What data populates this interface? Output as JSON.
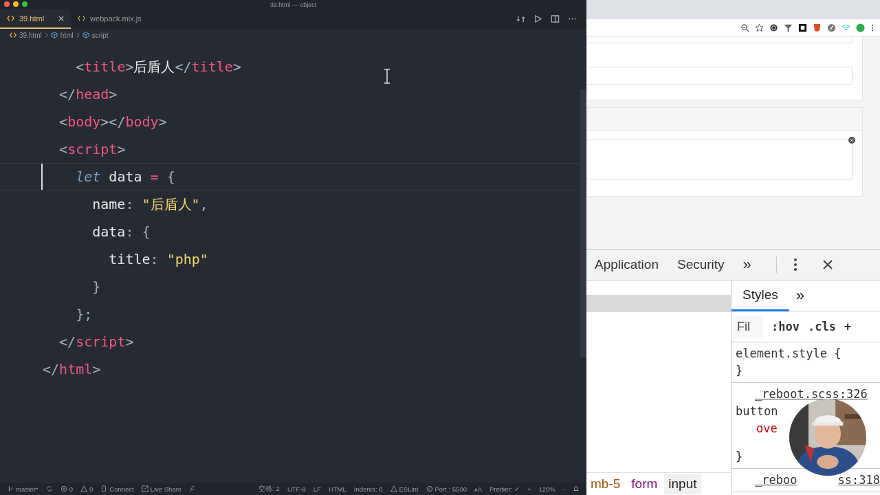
{
  "editor": {
    "window_title": "39.html — object",
    "tabs": [
      {
        "label": "39.html",
        "selected": true,
        "kind": "html"
      },
      {
        "label": "webpack.mix.js",
        "selected": false,
        "kind": "js"
      }
    ],
    "breadcrumb": [
      {
        "label": "39.html",
        "kind": "html"
      },
      {
        "label": "html",
        "kind": "element"
      },
      {
        "label": "script",
        "kind": "element"
      }
    ],
    "lines": [
      {
        "current": false,
        "tokens": [
          {
            "kind": "punct",
            "text": "    <"
          },
          {
            "kind": "tag",
            "text": "title"
          },
          {
            "kind": "punct",
            "text": ">"
          },
          {
            "kind": "text",
            "text": "后盾人"
          },
          {
            "kind": "punct",
            "text": "</"
          },
          {
            "kind": "tag",
            "text": "title"
          },
          {
            "kind": "punct",
            "text": ">"
          }
        ]
      },
      {
        "current": false,
        "tokens": [
          {
            "kind": "punct",
            "text": "  </"
          },
          {
            "kind": "tag",
            "text": "head"
          },
          {
            "kind": "punct",
            "text": ">"
          }
        ]
      },
      {
        "current": false,
        "tokens": [
          {
            "kind": "punct",
            "text": "  <"
          },
          {
            "kind": "tag",
            "text": "body"
          },
          {
            "kind": "punct",
            "text": "></"
          },
          {
            "kind": "tag",
            "text": "body"
          },
          {
            "kind": "punct",
            "text": ">"
          }
        ]
      },
      {
        "current": false,
        "tokens": [
          {
            "kind": "punct",
            "text": "  <"
          },
          {
            "kind": "tag",
            "text": "script"
          },
          {
            "kind": "punct",
            "text": ">"
          }
        ]
      },
      {
        "current": true,
        "tokens": [
          {
            "kind": "keyword",
            "text": "    let"
          },
          {
            "kind": "ident",
            "text": " data "
          },
          {
            "kind": "op",
            "text": "="
          },
          {
            "kind": "punct",
            "text": " {"
          }
        ]
      },
      {
        "current": false,
        "tokens": [
          {
            "kind": "ident",
            "text": "      name"
          },
          {
            "kind": "punct",
            "text": ": "
          },
          {
            "kind": "string",
            "text": "\"后盾人\""
          },
          {
            "kind": "punct",
            "text": ","
          }
        ]
      },
      {
        "current": false,
        "tokens": [
          {
            "kind": "ident",
            "text": "      data"
          },
          {
            "kind": "punct",
            "text": ": {"
          }
        ]
      },
      {
        "current": false,
        "tokens": [
          {
            "kind": "ident",
            "text": "        title"
          },
          {
            "kind": "punct",
            "text": ": "
          },
          {
            "kind": "string",
            "text": "\"php\""
          }
        ]
      },
      {
        "current": false,
        "tokens": [
          {
            "kind": "punct",
            "text": "      }"
          }
        ]
      },
      {
        "current": false,
        "tokens": [
          {
            "kind": "punct",
            "text": "    };"
          }
        ]
      },
      {
        "current": false,
        "tokens": [
          {
            "kind": "punct",
            "text": "  </"
          },
          {
            "kind": "tag",
            "text": "script"
          },
          {
            "kind": "punct",
            "text": ">"
          }
        ]
      },
      {
        "current": false,
        "tokens": [
          {
            "kind": "punct",
            "text": "</"
          },
          {
            "kind": "tag",
            "text": "html"
          },
          {
            "kind": "punct",
            "text": ">"
          }
        ]
      }
    ],
    "status_left": [
      {
        "kind": "branch",
        "text": "master*"
      },
      {
        "kind": "sync"
      },
      {
        "kind": "errors",
        "text": "0"
      },
      {
        "kind": "warnings",
        "text": "0"
      },
      {
        "kind": "database",
        "text": "Connect"
      },
      {
        "kind": "share",
        "text": "Live Share"
      },
      {
        "kind": "feedback"
      }
    ],
    "status_right": [
      {
        "kind": "plain",
        "text": "空格: 2"
      },
      {
        "kind": "plain",
        "text": "UTF-8"
      },
      {
        "kind": "plain",
        "text": "LF"
      },
      {
        "kind": "plain",
        "text": "HTML"
      },
      {
        "kind": "plain",
        "text": "Indents: 0"
      },
      {
        "kind": "warning",
        "text": "ESLint"
      },
      {
        "kind": "port",
        "text": "Port : 5500"
      },
      {
        "kind": "font",
        "text": "ᴀA"
      },
      {
        "kind": "plain",
        "text": "Prettier: ✓"
      },
      {
        "kind": "plain",
        "text": "+"
      },
      {
        "kind": "plain",
        "text": "120%"
      },
      {
        "kind": "plain",
        "text": "-"
      },
      {
        "kind": "bell"
      }
    ]
  },
  "devtools": {
    "tabs": [
      {
        "label": "Application",
        "selected": false
      },
      {
        "label": "Security",
        "selected": false
      }
    ],
    "more": "»",
    "breadcrumb": [
      {
        "label": "mb-5",
        "kind": "class",
        "selected": false
      },
      {
        "label": "form",
        "kind": "tag",
        "selected": false
      },
      {
        "label": "input",
        "kind": "tag",
        "selected": true
      }
    ],
    "styles_tab": {
      "label": "Styles",
      "selected": true
    },
    "filter_placeholder": "Fil",
    "filter_buttons": [
      ":hov",
      ".cls",
      "+"
    ],
    "rules": [
      {
        "lines": [
          {
            "kind": "selector",
            "text": "element.style {"
          },
          {
            "kind": "brace",
            "text": "}"
          }
        ]
      },
      {
        "lines": [
          {
            "kind": "source",
            "text": "_reboot.scss:326"
          },
          {
            "kind": "selector",
            "text": "button"
          },
          {
            "kind": "prop",
            "text": "ove"
          },
          {
            "kind": "brace",
            "text": "}"
          }
        ]
      },
      {
        "lines": [
          {
            "kind": "source",
            "text": "_reboo",
            "tail": "ss:318"
          }
        ]
      }
    ]
  }
}
